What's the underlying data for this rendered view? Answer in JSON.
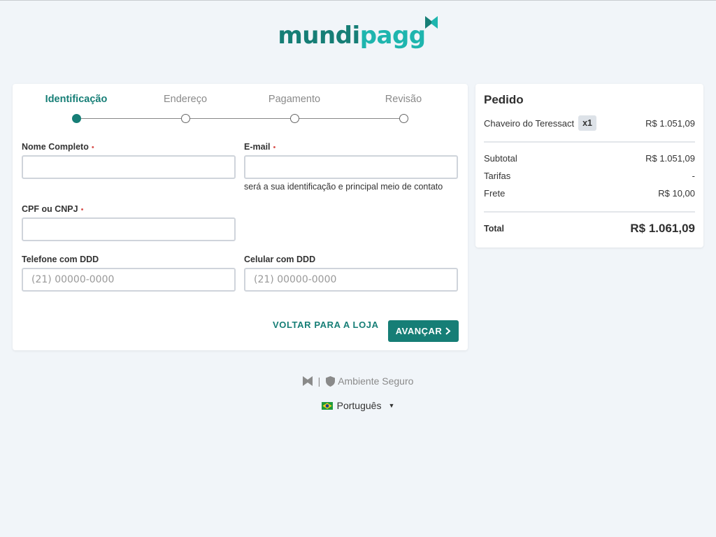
{
  "brand": {
    "name_part1": "mundi",
    "name_part2": "pagg",
    "primary_color": "#167e76",
    "accent_color": "#1eb5ae"
  },
  "stepper": {
    "steps": [
      {
        "label": "Identificação",
        "active": true
      },
      {
        "label": "Endereço",
        "active": false
      },
      {
        "label": "Pagamento",
        "active": false
      },
      {
        "label": "Revisão",
        "active": false
      }
    ]
  },
  "form": {
    "full_name": {
      "label": "Nome Completo",
      "required_mark": "•",
      "value": ""
    },
    "email": {
      "label": "E-mail",
      "required_mark": "•",
      "value": "",
      "hint": "será a sua identificação e principal meio de contato"
    },
    "document": {
      "label": "CPF ou CNPJ",
      "required_mark": "•",
      "value": ""
    },
    "phone": {
      "label": "Telefone com DDD",
      "placeholder": "(21) 00000-0000"
    },
    "mobile": {
      "label": "Celular com DDD",
      "placeholder": "(21) 00000-0000"
    },
    "back_label": "VOLTAR PARA A LOJA",
    "next_label": "AVANÇAR"
  },
  "order": {
    "title": "Pedido",
    "item": {
      "name": "Chaveiro do Teressact",
      "quantity": "x1",
      "price": "R$ 1.051,09"
    },
    "subtotal": {
      "label": "Subtotal",
      "value": "R$ 1.051,09"
    },
    "fees": {
      "label": "Tarifas",
      "value": "-"
    },
    "shipping": {
      "label": "Frete",
      "value": "R$ 10,00"
    },
    "total": {
      "label": "Total",
      "value": "R$ 1.061,09"
    }
  },
  "footer": {
    "separator": "|",
    "secure_label": "Ambiente Seguro",
    "language": "Português"
  }
}
